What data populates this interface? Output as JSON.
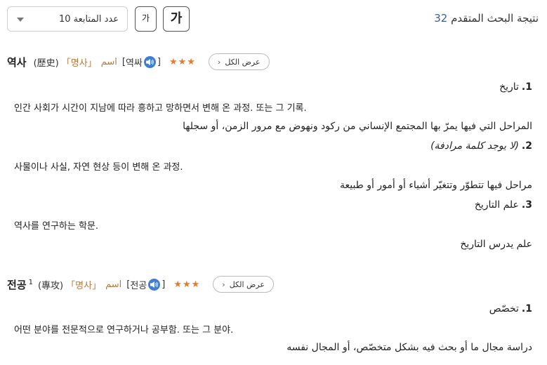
{
  "toolbar": {
    "sort_label": "عدد المتابعة 10",
    "font_small": "가",
    "font_large": "가",
    "result_label": "نتيجة البحث المتقدم",
    "result_count": "32"
  },
  "entries": [
    {
      "headword": "역사",
      "homonym": "",
      "hanja": "(歷史)",
      "bracket_open": "「",
      "pos_ko": "명사",
      "bracket_close": "」",
      "pos_ar": "اسم",
      "pron_open": "[",
      "pron": "역싸",
      "pron_close": "]",
      "stars": "★★★",
      "view_all": "عرض الكل",
      "senses": [
        {
          "n": "1.",
          "title": "تاريخ",
          "note": "",
          "ko_def": "인간 사회가 시간이 지남에 따라 흥하고 망하면서 변해 온 과정. 또는 그 기록.",
          "ar_def": "المراحل التي فيها يمرّ بها المجتمع الإنساني من ركود ونهوض مع مرور الزمن، أو سجلها"
        },
        {
          "n": "2.",
          "title": "",
          "note": "(لا يوجد كلمة مرادفة)",
          "ko_def": "사물이나 사실, 자연 현상 등이 변해 온 과정.",
          "ar_def": "مراحل فيها تتطوّر وتتغيّر أشياء أو أمور أو طبيعة"
        },
        {
          "n": "3.",
          "title": "علم التاريخ",
          "note": "",
          "ko_def": "역사를 연구하는 학문.",
          "ar_def": "علم يدرس التاريخ"
        }
      ]
    },
    {
      "headword": "전공",
      "homonym": "1",
      "hanja": "(專攻)",
      "bracket_open": "「",
      "pos_ko": "명사",
      "bracket_close": "」",
      "pos_ar": "اسم",
      "pron_open": "[",
      "pron": "전공",
      "pron_close": "]",
      "stars": "★★★",
      "view_all": "عرض الكل",
      "senses": [
        {
          "n": "1.",
          "title": "تخصّص",
          "note": "",
          "ko_def": "어떤 분야를 전문적으로 연구하거나 공부함. 또는 그 분야.",
          "ar_def": "دراسة مجال ما أو بحث فيه بشكل متخصّص، أو المجال نفسه"
        }
      ]
    }
  ]
}
